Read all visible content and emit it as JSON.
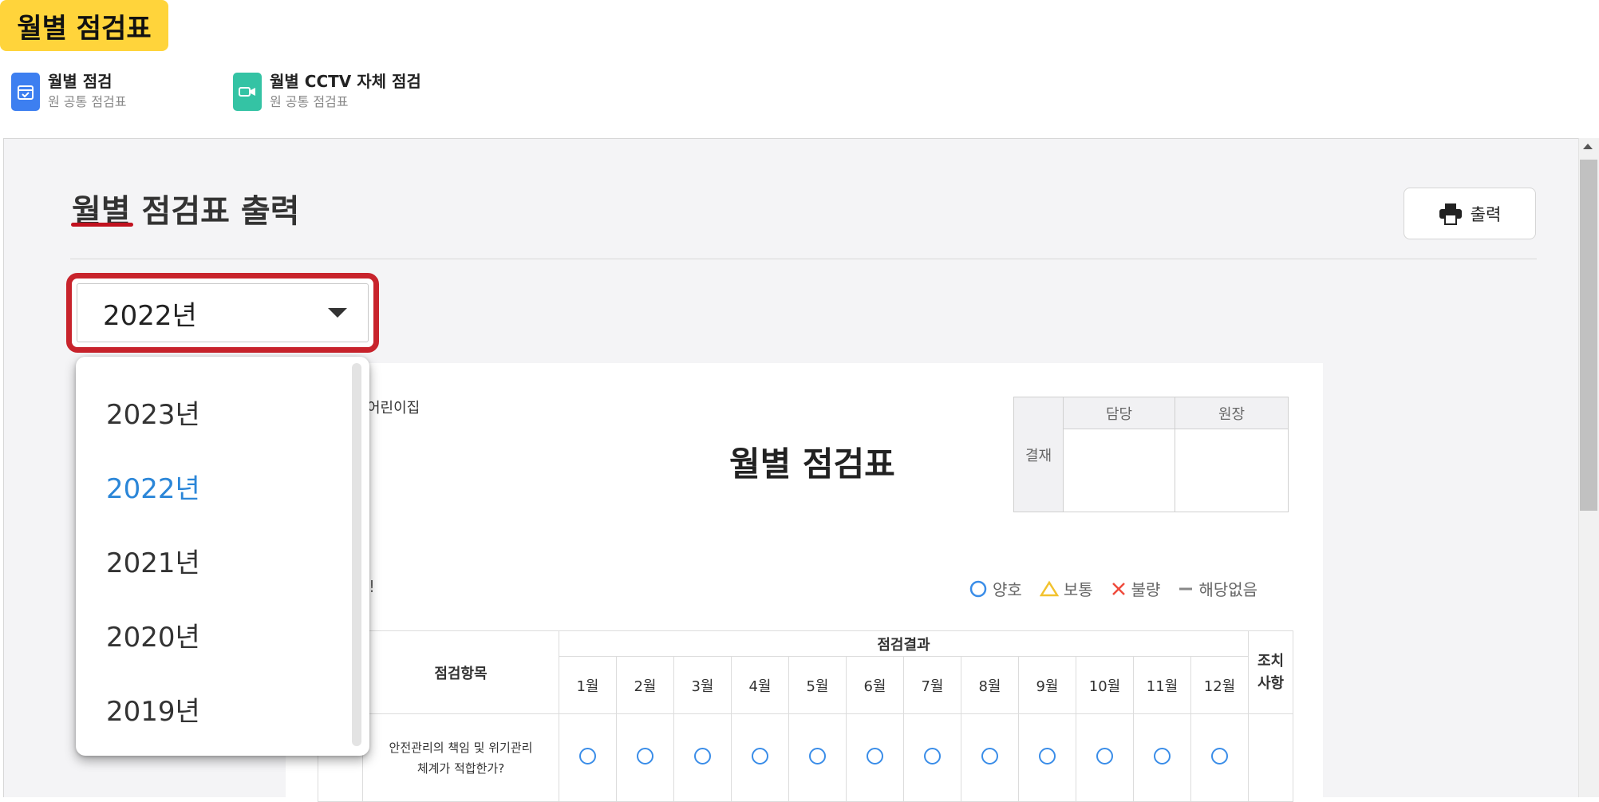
{
  "header": {
    "badge": "월별 점검표",
    "tabs": [
      {
        "title": "월별 점검",
        "subtitle": "원 공통 점검표",
        "icon": "calendar-check-icon",
        "color": "#3d7ff0"
      },
      {
        "title": "월별 CCTV 자체 점검",
        "subtitle": "원 공통 점검표",
        "icon": "video-camera-icon",
        "color": "#34c3a4"
      }
    ]
  },
  "main": {
    "title": "월별 점검표 출력",
    "print_label": "출력"
  },
  "year_select": {
    "value": "2022년",
    "options": [
      "2023년",
      "2022년",
      "2021년",
      "2020년",
      "2019년"
    ],
    "selected_index": 1
  },
  "sheet": {
    "daycare_name": "어린이집",
    "title": "월별 점검표",
    "approval": {
      "row_label": "결재",
      "columns": [
        "담당",
        "원장"
      ]
    },
    "partial_mark": "!",
    "legend": [
      {
        "symbol": "circle",
        "label": "양호",
        "color": "#3a8de8"
      },
      {
        "symbol": "triangle",
        "label": "보통",
        "color": "#f2c22e"
      },
      {
        "symbol": "cross",
        "label": "불량",
        "color": "#ef4b3c"
      },
      {
        "symbol": "dash",
        "label": "해당없음",
        "color": "#888888"
      }
    ],
    "table": {
      "item_header": "점검항목",
      "result_header": "점검결과",
      "months": [
        "1월",
        "2월",
        "3월",
        "4월",
        "5월",
        "6월",
        "7월",
        "8월",
        "9월",
        "10월",
        "11월",
        "12월"
      ],
      "action_header_line1": "조치",
      "action_header_line2": "사항",
      "rows": [
        {
          "item_line1": "안전관리의 책임 및 위기관리",
          "item_line2": "체계가 적합한가?",
          "results": [
            "circle",
            "circle",
            "circle",
            "circle",
            "circle",
            "circle",
            "circle",
            "circle",
            "circle",
            "circle",
            "circle",
            "circle"
          ]
        }
      ]
    }
  }
}
